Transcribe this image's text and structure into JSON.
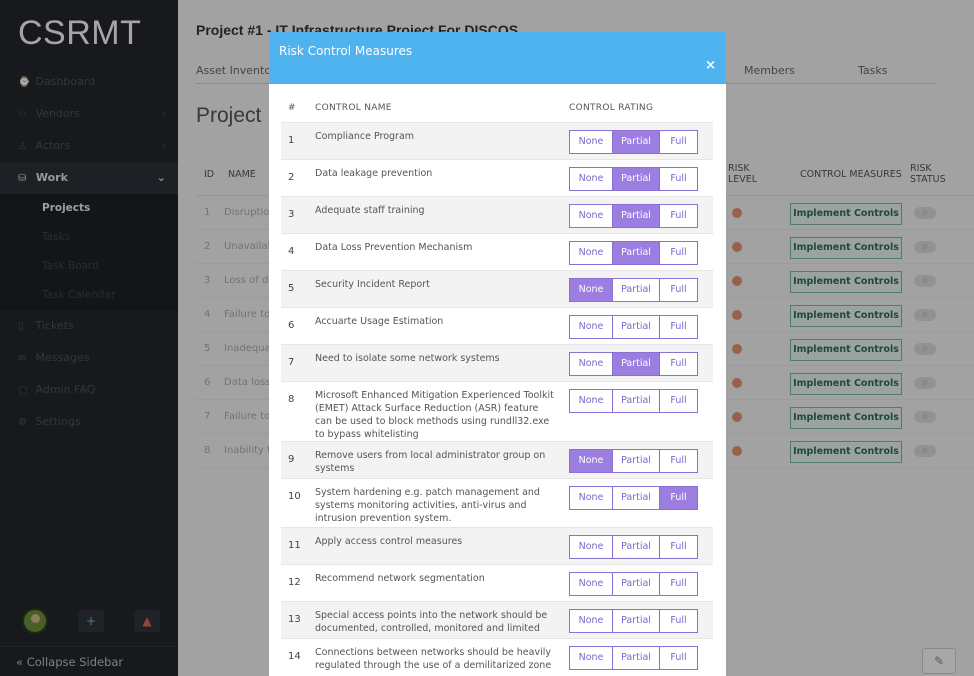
{
  "app": {
    "logo": "CSRMT"
  },
  "sidebar": {
    "items": [
      {
        "label": "Dashboard",
        "icon": "⌚"
      },
      {
        "label": "Vendors",
        "icon": "⚇"
      },
      {
        "label": "Actors",
        "icon": "♙"
      },
      {
        "label": "Work",
        "icon": "⛁"
      }
    ],
    "sub_items": [
      "Projects",
      "Tasks",
      "Task Board",
      "Task Calendar"
    ],
    "items2": [
      {
        "label": "Tickets",
        "icon": "▯"
      },
      {
        "label": "Messages",
        "icon": "✉"
      },
      {
        "label": "Admin FAQ",
        "icon": "▢"
      },
      {
        "label": "Settings",
        "icon": "⚙"
      }
    ],
    "collapse_label": "« Collapse Sidebar",
    "plus_icon": "+",
    "bell_icon": "▲"
  },
  "main": {
    "project_title": "Project #1 - IT Infrastructure Project For DISCOS",
    "tabs": [
      "Asset Inventory",
      "Members",
      "Tasks"
    ],
    "page_heading": "Project Risks",
    "columns": {
      "id": "ID",
      "name": "NAME",
      "risk_level": "RISK LEVEL",
      "control_measures": "CONTROL MEASURES",
      "risk_status": "RISK STATUS"
    },
    "rows": [
      {
        "id": "1",
        "name": "Disruption",
        "action": "Implement Controls",
        "status": "0"
      },
      {
        "id": "2",
        "name": "Unavailab",
        "action": "Implement Controls",
        "status": "0"
      },
      {
        "id": "3",
        "name": "Loss of da",
        "action": "Implement Controls",
        "status": "0"
      },
      {
        "id": "4",
        "name": "Failure to organisat",
        "action": "Implement Controls",
        "status": "0"
      },
      {
        "id": "5",
        "name": "Inadequa",
        "action": "Implement Controls",
        "status": "0"
      },
      {
        "id": "6",
        "name": "Data loss",
        "action": "Implement Controls",
        "status": "0"
      },
      {
        "id": "7",
        "name": "Failure to",
        "action": "Implement Controls",
        "status": "0"
      },
      {
        "id": "8",
        "name": "Inability t services",
        "action": "Implement Controls",
        "status": "0"
      }
    ]
  },
  "modal": {
    "title": "Risk Control Measures",
    "close": "×",
    "col_num": "#",
    "col_name": "CONTROL NAME",
    "col_rating": "CONTROL RATING",
    "options": [
      "None",
      "Partial",
      "Full"
    ],
    "rows": [
      {
        "num": "1",
        "name": "Compliance Program",
        "rating": "Partial"
      },
      {
        "num": "2",
        "name": "Data leakage prevention",
        "rating": "Partial"
      },
      {
        "num": "3",
        "name": "Adequate staff training",
        "rating": "Partial"
      },
      {
        "num": "4",
        "name": "Data Loss Prevention Mechanism",
        "rating": "Partial"
      },
      {
        "num": "5",
        "name": "Security Incident Report",
        "rating": "None"
      },
      {
        "num": "6",
        "name": "Accuarte Usage Estimation",
        "rating": ""
      },
      {
        "num": "7",
        "name": "Need to isolate some network systems",
        "rating": "Partial"
      },
      {
        "num": "8",
        "name": "Microsoft Enhanced Mitigation Experienced Toolkit (EMET) Attack Surface Reduction (ASR) feature can be used to block methods using rundll32.exe to bypass whitelisting",
        "rating": ""
      },
      {
        "num": "9",
        "name": "Remove users from local administrator group on systems",
        "rating": "None"
      },
      {
        "num": "10",
        "name": "System hardening e.g. patch management and systems monitoring activities, anti-virus and intrusion prevention system.",
        "rating": "Full"
      },
      {
        "num": "11",
        "name": "Apply access control measures",
        "rating": ""
      },
      {
        "num": "12",
        "name": "Recommend network segmentation",
        "rating": ""
      },
      {
        "num": "13",
        "name": "Special access points into the network should be documented, controlled, monitored and limited",
        "rating": ""
      },
      {
        "num": "14",
        "name": "Connections between networks should be heavily regulated through the use of a demilitarized zone",
        "rating": ""
      }
    ]
  },
  "colors": {
    "modal_header": "#4fb3f0",
    "rating_selected": "#9b7ee0",
    "sidebar": "#22262c"
  }
}
